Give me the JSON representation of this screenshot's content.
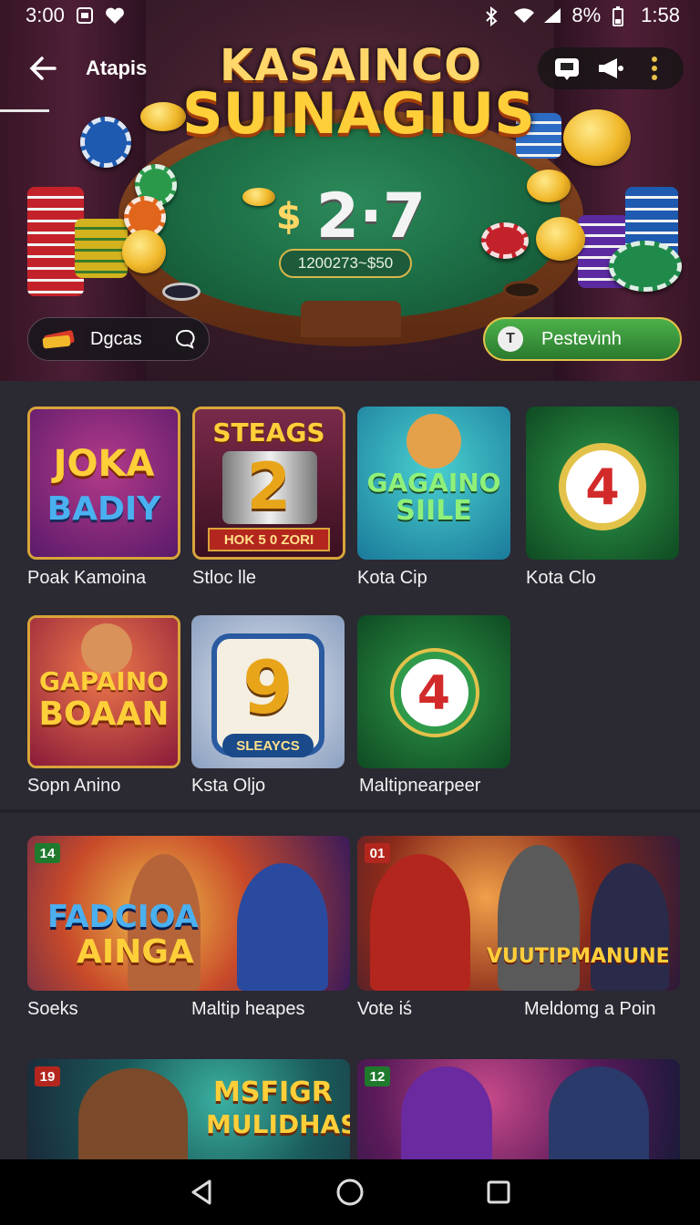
{
  "status_bar": {
    "time": "3:00",
    "battery_text": "8%",
    "clock_right": "1:58"
  },
  "app_bar": {
    "title": "Atapis"
  },
  "hero": {
    "title_line1": "KASAINCO",
    "title_line2": "SUINAGIUS",
    "jackpot_currency": "$",
    "jackpot_value": "2·7",
    "jackpot_sub": "1200273~$50",
    "left_pill_label": "Dgcas",
    "right_pill_label": "Pestevinh",
    "right_pill_icon_letter": "T"
  },
  "games_small": [
    {
      "label": "Poak Kamoina",
      "art_line1": "JOKA",
      "art_line2": "BADIY"
    },
    {
      "label": "Stloc lle",
      "art_line1": "STEAGS",
      "art_line2": "2",
      "art_line3": "HOK 5 0 ZORI"
    },
    {
      "label": "Kota Cip",
      "art_line1": "GAGAINO",
      "art_line2": "SIILE"
    },
    {
      "label": "Kota Clo",
      "art_line1": "4"
    },
    {
      "label": "Sopn Anino",
      "art_line1": "GAPAINO",
      "art_line2": "BOAAN"
    },
    {
      "label": "Ksta Oljo",
      "art_line1": "9",
      "art_line2": "SLEAYCS"
    },
    {
      "label": "Maltipnearpeer",
      "art_line1": "4"
    }
  ],
  "games_large": [
    {
      "badge": "14",
      "badge_color": "#1f7a2e",
      "art_line1": "FADCIOA",
      "art_line2": "AINGA",
      "labels": [
        "Soeks",
        "Maltip heapes"
      ]
    },
    {
      "badge": "01",
      "badge_color": "#b3261e",
      "art_line1": "VUUTIPMANUNE",
      "art_line2": "",
      "labels": [
        "Vote iś",
        "Meldomg a Poin"
      ]
    },
    {
      "badge": "19",
      "badge_color": "#b3261e",
      "art_line1": "MSFIGR",
      "art_line2": "MULIDHAS",
      "labels": []
    },
    {
      "badge": "12",
      "badge_color": "#1f7a2e",
      "art_line1": "",
      "art_line2": "",
      "labels": []
    }
  ],
  "colors": {
    "bg": "#2b2932",
    "accent_green": "#4cb14a",
    "accent_gold": "#e3c24a"
  }
}
